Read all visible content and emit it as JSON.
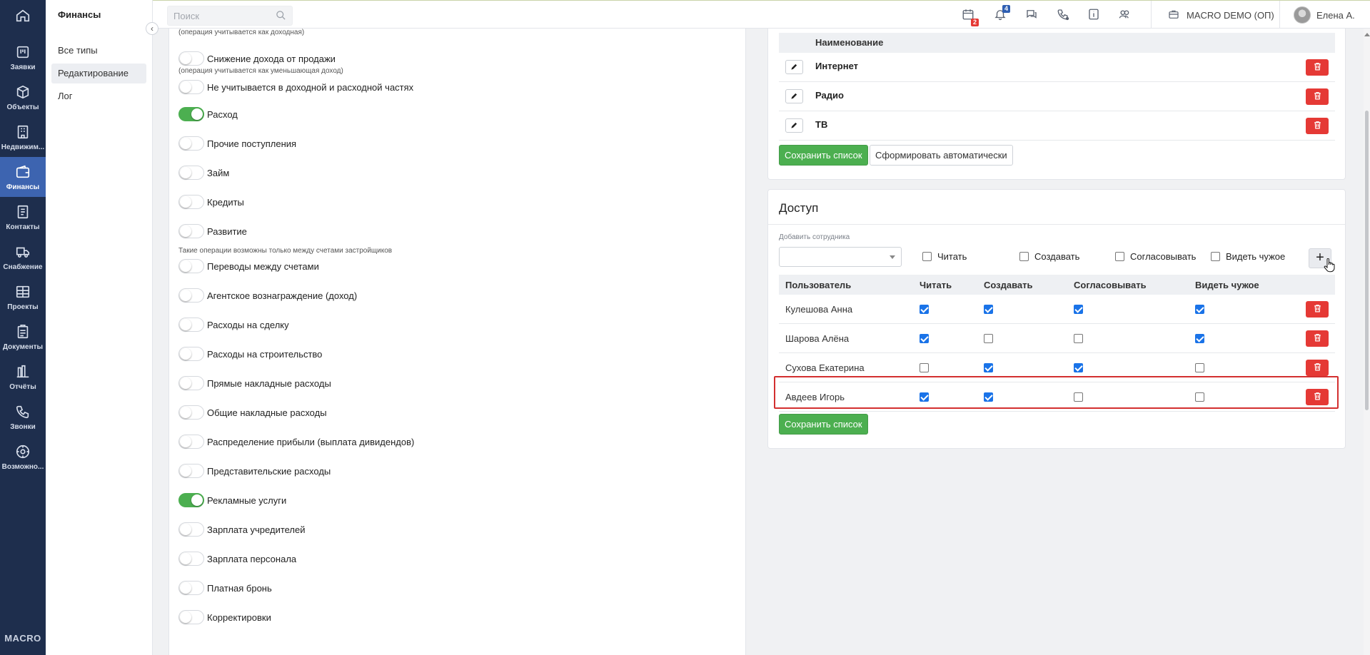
{
  "rail": {
    "items": [
      {
        "label": "Заявки",
        "icon": "requests-icon"
      },
      {
        "label": "Объекты",
        "icon": "box-icon"
      },
      {
        "label": "Недвижим...",
        "icon": "building-icon"
      },
      {
        "label": "Финансы",
        "icon": "wallet-icon",
        "active": true
      },
      {
        "label": "Контакты",
        "icon": "contacts-icon"
      },
      {
        "label": "Снабжение",
        "icon": "truck-icon"
      },
      {
        "label": "Проекты",
        "icon": "projects-icon"
      },
      {
        "label": "Документы",
        "icon": "clipboard-icon"
      },
      {
        "label": "Отчёты",
        "icon": "reports-icon"
      },
      {
        "label": "Звонки",
        "icon": "phone-icon"
      },
      {
        "label": "Возможно...",
        "icon": "gear-icon"
      }
    ],
    "brand": "MACRO"
  },
  "sub_sidebar": {
    "title": "Финансы",
    "items": [
      {
        "label": "Все типы"
      },
      {
        "label": "Редактирование",
        "selected": true
      },
      {
        "label": "Лог"
      }
    ]
  },
  "topbar": {
    "search_placeholder": "Поиск",
    "calendar_badge": "2",
    "notifications_badge": "4",
    "org_name": "MACRO DEMO (ОП)",
    "user_name": "Елена А."
  },
  "toggles": [
    {
      "label": "(операция учитывается как доходная)",
      "kind": "note"
    },
    {
      "label": "Снижение дохода от продажи",
      "on": false
    },
    {
      "label": "(операция учитывается как уменьшающая доход)",
      "kind": "note"
    },
    {
      "label": "Не учитывается в доходной и расходной частях",
      "on": false
    },
    {
      "label": "Расход",
      "on": true
    },
    {
      "label": "Прочие поступления",
      "on": false
    },
    {
      "label": "Займ",
      "on": false
    },
    {
      "label": "Кредиты",
      "on": false
    },
    {
      "label": "Развитие",
      "on": false
    },
    {
      "label": "Такие операции возможны только между счетами застройщиков",
      "kind": "note"
    },
    {
      "label": "Переводы между счетами",
      "on": false
    },
    {
      "label": "Агентское вознаграждение (доход)",
      "on": false
    },
    {
      "label": "Расходы на сделку",
      "on": false
    },
    {
      "label": "Расходы на строительство",
      "on": false
    },
    {
      "label": "Прямые накладные расходы",
      "on": false
    },
    {
      "label": "Общие накладные расходы",
      "on": false
    },
    {
      "label": "Распределение прибыли (выплата дивидендов)",
      "on": false
    },
    {
      "label": "Представительские расходы",
      "on": false
    },
    {
      "label": "Рекламные услуги",
      "on": true
    },
    {
      "label": "Зарплата учредителей",
      "on": false
    },
    {
      "label": "Зарплата персонала",
      "on": false
    },
    {
      "label": "Платная бронь",
      "on": false
    },
    {
      "label": "Корректировки",
      "on": false
    }
  ],
  "list_card": {
    "header": "Наименование",
    "rows": [
      "Интернет",
      "Радио",
      "ТВ"
    ],
    "save_label": "Сохранить список",
    "auto_label": "Сформировать автоматически"
  },
  "access_card": {
    "title": "Доступ",
    "add_label": "Добавить сотрудника",
    "options": [
      "Читать",
      "Создавать",
      "Согласовывать",
      "Видеть чужое"
    ],
    "plus_label": "+",
    "columns": [
      "Пользователь",
      "Читать",
      "Создавать",
      "Согласовывать",
      "Видеть чужое"
    ],
    "rows": [
      {
        "user": "Кулешова Анна",
        "read": true,
        "create": true,
        "approve": true,
        "see_others": true
      },
      {
        "user": "Шарова Алёна",
        "read": true,
        "create": false,
        "approve": false,
        "see_others": true
      },
      {
        "user": "Сухова Екатерина",
        "read": false,
        "create": true,
        "approve": true,
        "see_others": false
      },
      {
        "user": "Авдеев Игорь",
        "read": true,
        "create": true,
        "approve": false,
        "see_others": false,
        "highlighted": true
      }
    ],
    "save_label": "Сохранить список"
  }
}
